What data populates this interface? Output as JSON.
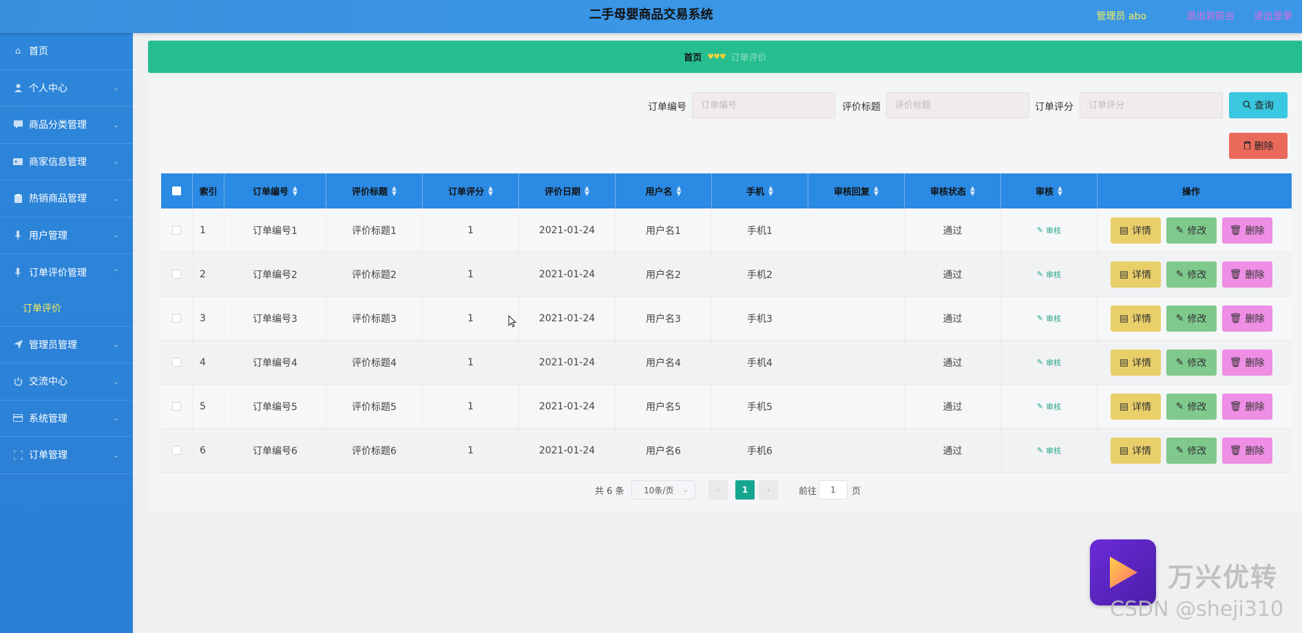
{
  "header": {
    "title": "二手母婴商品交易系统",
    "user_label": "管理员 abo",
    "back_home": "退出到前台",
    "logout": "退出登录"
  },
  "sidebar": {
    "items": [
      {
        "label": "首页",
        "icon": "home-icon"
      },
      {
        "label": "个人中心",
        "icon": "user-icon"
      },
      {
        "label": "商品分类管理",
        "icon": "chat-icon"
      },
      {
        "label": "商家信息管理",
        "icon": "ticket-icon"
      },
      {
        "label": "热销商品管理",
        "icon": "clipboard-icon"
      },
      {
        "label": "用户管理",
        "icon": "mic-icon"
      },
      {
        "label": "订单评价管理",
        "icon": "mic-icon"
      },
      {
        "label": "管理员管理",
        "icon": "send-icon"
      },
      {
        "label": "交流中心",
        "icon": "power-icon"
      },
      {
        "label": "系统管理",
        "icon": "card-icon"
      },
      {
        "label": "订单管理",
        "icon": "fullscreen-icon"
      }
    ],
    "subitem": "订单评价"
  },
  "breadcrumb": {
    "home": "首页",
    "separator": "♥♥♥",
    "current": "订单评价"
  },
  "search": {
    "order_no_label": "订单编号",
    "order_no_placeholder": "订单编号",
    "title_label": "评价标题",
    "title_placeholder": "评价标题",
    "rating_label": "订单评分",
    "rating_placeholder": "订单评分",
    "query_button": "查询",
    "delete_button": "删除"
  },
  "table": {
    "columns": [
      "索引",
      "订单编号",
      "评价标题",
      "订单评分",
      "评价日期",
      "用户名",
      "手机",
      "审核回复",
      "审核状态",
      "审核",
      "操作"
    ],
    "rows": [
      {
        "index": "1",
        "order_no": "订单编号1",
        "title": "评价标题1",
        "rating": "1",
        "date": "2021-01-24",
        "username": "用户名1",
        "phone": "手机1",
        "reply": "",
        "status": "通过"
      },
      {
        "index": "2",
        "order_no": "订单编号2",
        "title": "评价标题2",
        "rating": "1",
        "date": "2021-01-24",
        "username": "用户名2",
        "phone": "手机2",
        "reply": "",
        "status": "通过"
      },
      {
        "index": "3",
        "order_no": "订单编号3",
        "title": "评价标题3",
        "rating": "1",
        "date": "2021-01-24",
        "username": "用户名3",
        "phone": "手机3",
        "reply": "",
        "status": "通过"
      },
      {
        "index": "4",
        "order_no": "订单编号4",
        "title": "评价标题4",
        "rating": "1",
        "date": "2021-01-24",
        "username": "用户名4",
        "phone": "手机4",
        "reply": "",
        "status": "通过"
      },
      {
        "index": "5",
        "order_no": "订单编号5",
        "title": "评价标题5",
        "rating": "1",
        "date": "2021-01-24",
        "username": "用户名5",
        "phone": "手机5",
        "reply": "",
        "status": "通过"
      },
      {
        "index": "6",
        "order_no": "订单编号6",
        "title": "评价标题6",
        "rating": "1",
        "date": "2021-01-24",
        "username": "用户名6",
        "phone": "手机6",
        "reply": "",
        "status": "通过"
      }
    ],
    "audit_link": "审核",
    "detail_button": "详情",
    "edit_button": "修改",
    "delete_button": "删除"
  },
  "pagination": {
    "total": "共 6 条",
    "page_size": "10条/页",
    "current_page": "1",
    "goto_label": "前往",
    "goto_value": "1",
    "page_word": "页"
  },
  "watermark": {
    "brand": "万兴优转",
    "credit": "CSDN @sheji310"
  },
  "colors": {
    "header": "#3a97e6",
    "sidebar": "#2b83d8",
    "breadcrumb": "#27be8f",
    "table_header": "#2b8ae3",
    "query_button": "#3ac7e0",
    "delete_button": "#e96a5b",
    "detail_button": "#e8cf6a",
    "edit_button": "#7fc98c",
    "row_delete_button": "#ee8ee4",
    "active_sub": "#f6ef5a"
  }
}
